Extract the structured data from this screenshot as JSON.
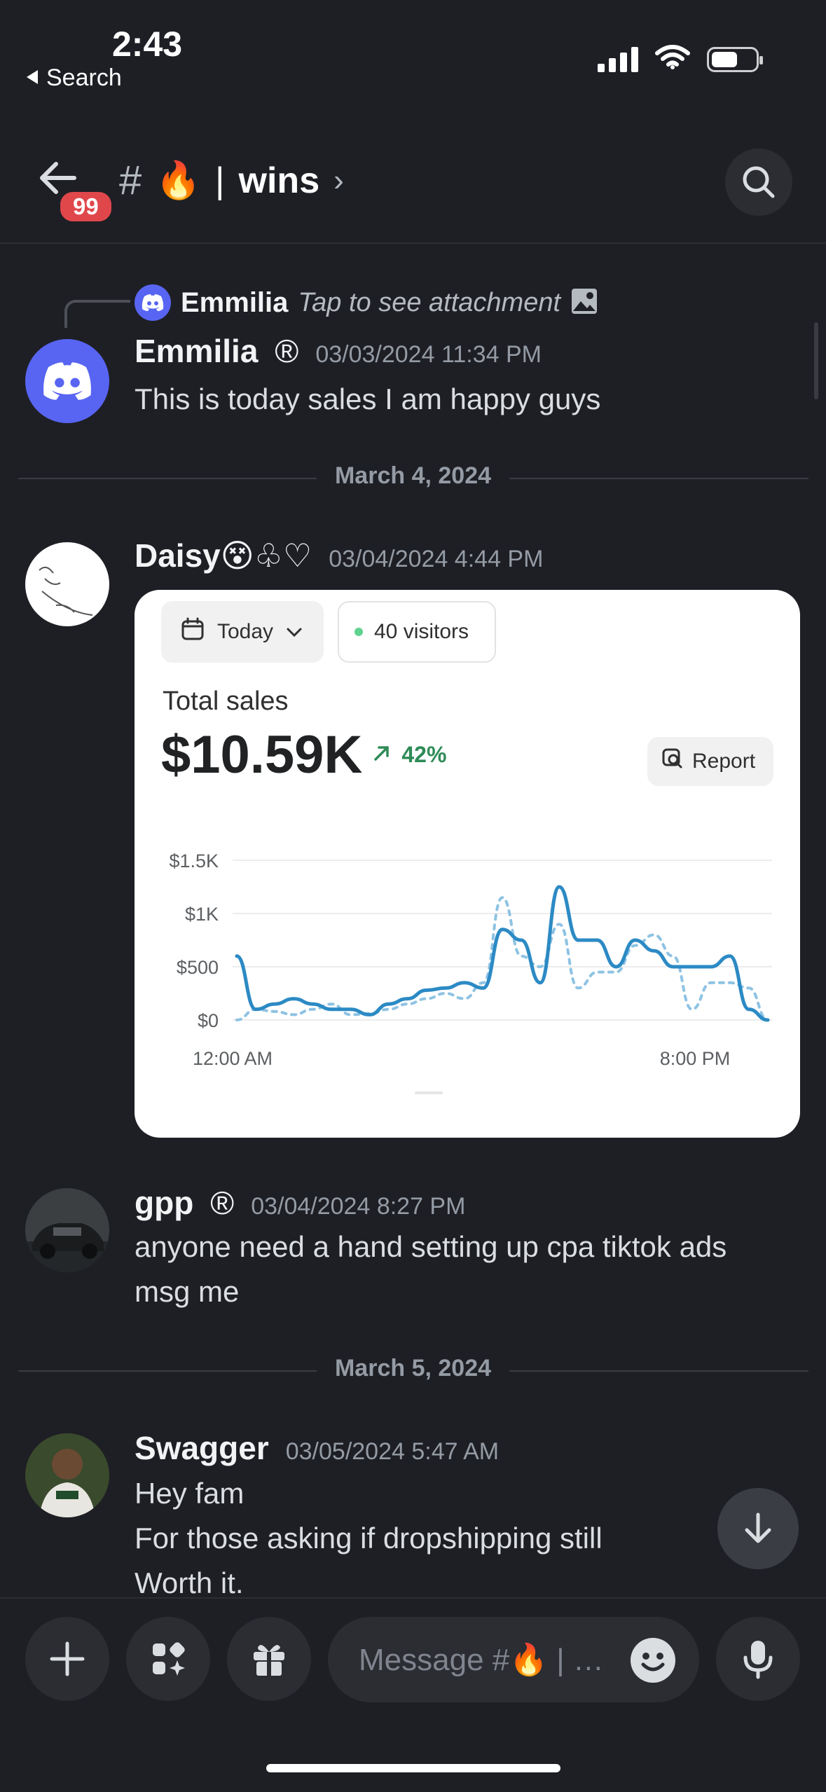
{
  "status_bar": {
    "time": "2:43",
    "back_label": "Search"
  },
  "header": {
    "badge": "99",
    "channel_emoji": "🔥",
    "channel_name": "wins"
  },
  "reply": {
    "username": "Emmilia",
    "text": "Tap to see attachment"
  },
  "messages": [
    {
      "username": "Emmilia",
      "timestamp": "03/03/2024 11:34 PM",
      "text": "This is today sales I am happy guys"
    },
    {
      "username": "Daisy😵♧♡",
      "timestamp": "03/04/2024 4:44 PM"
    },
    {
      "username": "gpp",
      "timestamp": "03/04/2024 8:27 PM",
      "text_line1": "anyone need a hand setting up cpa tiktok ads",
      "text_line2": "msg me"
    },
    {
      "username": "Swagger",
      "timestamp": "03/05/2024 5:47 AM",
      "text_line1": "Hey fam",
      "text_line2": "For those asking if dropshipping still",
      "text_line3": "Worth it."
    }
  ],
  "dividers": [
    "March 4, 2024",
    "March 5, 2024"
  ],
  "attachment": {
    "date_filter": "Today",
    "visitors": "40 visitors",
    "total_label": "Total sales",
    "total_value": "$10.59K",
    "change": "42%",
    "report_label": "Report",
    "y_ticks": [
      "$1.5K",
      "$1K",
      "$500",
      "$0"
    ],
    "x_ticks": [
      "12:00 AM",
      "8:00 PM"
    ]
  },
  "chart_data": {
    "type": "line",
    "ylim": [
      0,
      1500
    ],
    "x_labels": [
      "12:00 AM",
      "8:00 PM"
    ],
    "series": [
      {
        "values": [
          600,
          100,
          150,
          200,
          150,
          100,
          100,
          50,
          150,
          200,
          280,
          300,
          350,
          300,
          850,
          750,
          350,
          1250,
          750,
          750,
          500,
          750,
          650,
          500,
          500,
          500,
          600,
          100,
          0
        ]
      },
      {
        "values": [
          0,
          100,
          80,
          50,
          100,
          150,
          50,
          60,
          100,
          150,
          200,
          250,
          200,
          350,
          1150,
          600,
          500,
          900,
          300,
          450,
          450,
          700,
          800,
          600,
          100,
          350,
          350,
          300,
          0
        ]
      }
    ],
    "colors": [
      "#2c8ac4",
      "#8ec3e3"
    ]
  },
  "input": {
    "placeholder": "Message #🔥 | …"
  },
  "colors": {
    "background": "#1e1f25",
    "accent": "#5865f2",
    "badge": "#e0474b"
  }
}
